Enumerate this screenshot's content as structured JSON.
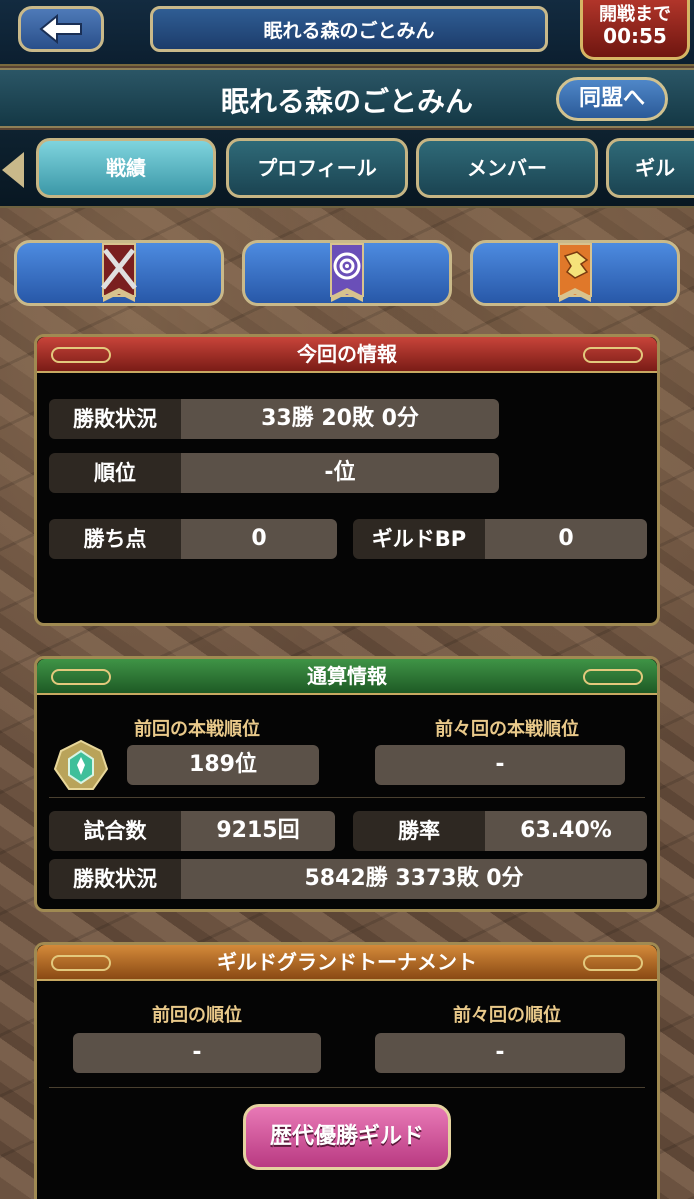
{
  "header": {
    "title": "眠れる森のごとみん",
    "timer_label": "開戦まで",
    "timer_value": "00:55"
  },
  "guild": {
    "name": "眠れる森のごとみん",
    "ally_button": "同盟へ"
  },
  "tabs": [
    {
      "label": "戦績",
      "active": true
    },
    {
      "label": "プロフィール",
      "active": false
    },
    {
      "label": "メンバー",
      "active": false
    },
    {
      "label": "ギル",
      "active": false
    }
  ],
  "category_icons": [
    "crossed-swords-icon",
    "swirl-banner-icon",
    "dragon-banner-icon"
  ],
  "current_info": {
    "title": "今回の情報",
    "record_label": "勝敗状況",
    "record_value": "33勝  20敗  0分",
    "rank_label": "順位",
    "rank_value": "-位",
    "points_label": "勝ち点",
    "points_value": "0",
    "bp_label": "ギルドBP",
    "bp_value": "0"
  },
  "total_info": {
    "title": "通算情報",
    "prev_rank_label": "前回の本戦順位",
    "prev_rank_value": "189位",
    "prev_prev_rank_label": "前々回の本戦順位",
    "prev_prev_rank_value": "-",
    "matches_label": "試合数",
    "matches_value": "9215回",
    "winrate_label": "勝率",
    "winrate_value": "63.40%",
    "record_label": "勝敗状況",
    "record_value": "5842勝  3373敗  0分"
  },
  "tournament": {
    "title": "ギルドグランドトーナメント",
    "prev_rank_label": "前回の順位",
    "prev_rank_value": "-",
    "prev_prev_rank_label": "前々回の順位",
    "prev_prev_rank_value": "-",
    "history_button": "歴代優勝ギルド"
  },
  "colors": {
    "tab_active": "#7fd4de",
    "head_red": "#c8443a",
    "head_green": "#3f9446",
    "head_orange": "#d48a3a",
    "history_button": "#e879b6"
  }
}
